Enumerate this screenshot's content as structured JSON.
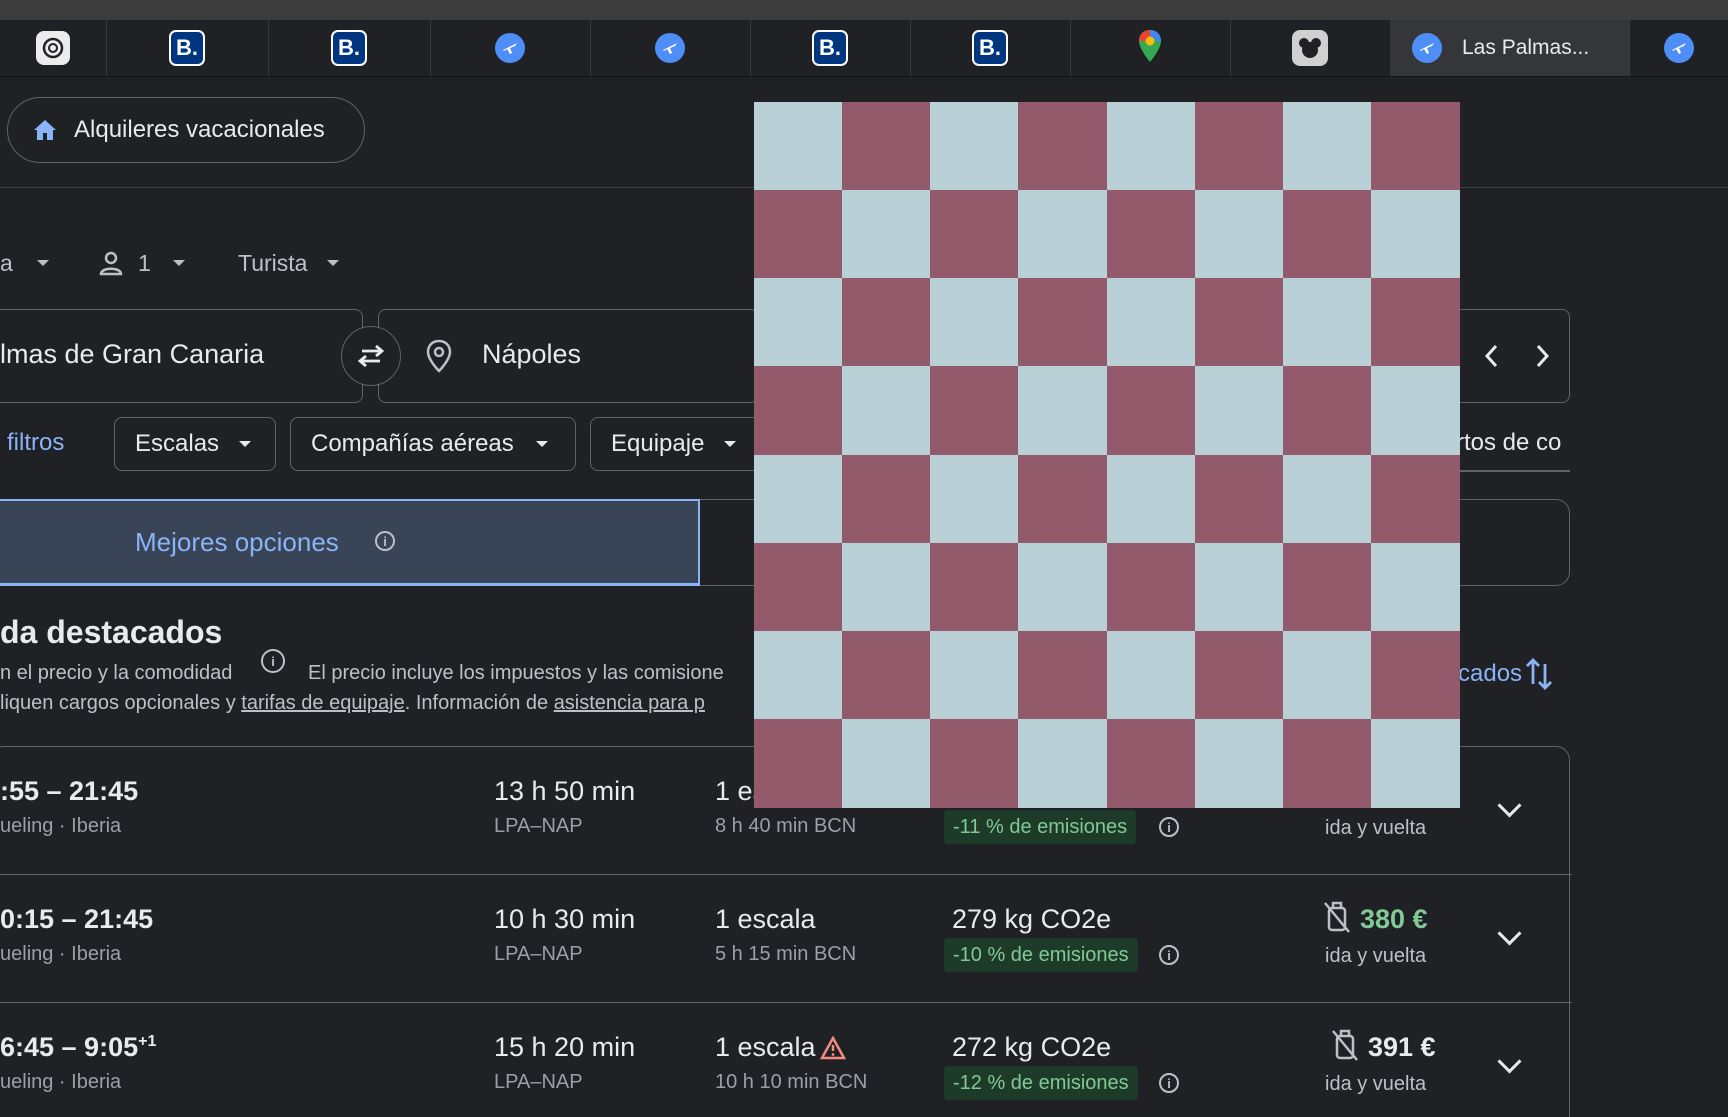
{
  "browser": {
    "active_tab_title": "Las Palmas...",
    "favicon_b_label": "B."
  },
  "header": {
    "vacation_rentals_label": "Alquileres vacacionales"
  },
  "search": {
    "trip_type_partial": "a",
    "passengers": "1",
    "cabin_class": "Turista",
    "origin": "lmas de Gran Canaria",
    "destination": "Nápoles",
    "partial_right_text": "rtos de co"
  },
  "filters": {
    "all_filters": "filtros",
    "stops": "Escalas",
    "airlines": "Compañías aéreas",
    "baggage": "Equipaje"
  },
  "tabs": {
    "best_options": "Mejores opciones"
  },
  "results": {
    "section_title": "da destacados",
    "subtitle_left": "n el precio y la comodidad",
    "price_note": "El precio incluye los impuestos y las comisione",
    "fees_prefix": "liquen cargos opcionales y ",
    "baggage_fees_link": "tarifas de equipaje",
    "info_prefix": ". Información de ",
    "assistance_link": "asistencia para p",
    "sort_partial": "cados",
    "flights": [
      {
        "times": ":55 – 21:45",
        "times_suffix": "",
        "airlines": "ueling · Iberia",
        "duration": "13 h 50 min",
        "route": "LPA–NAP",
        "stops": "1 es",
        "layover": "8 h 40 min BCN",
        "co2": "",
        "emissions": "-11 % de emisiones",
        "price": "",
        "price_note": "ida y vuelta"
      },
      {
        "times": "0:15 – 21:45",
        "times_suffix": "",
        "airlines": "ueling · Iberia",
        "duration": "10 h 30 min",
        "route": "LPA–NAP",
        "stops": "1 escala",
        "layover": "5 h 15 min BCN",
        "co2": "279 kg CO2e",
        "emissions": "-10 % de emisiones",
        "price": "380 €",
        "price_note": "ida y vuelta"
      },
      {
        "times": "6:45 – 9:05",
        "times_suffix": "+1",
        "airlines": "ueling · Iberia",
        "duration": "15 h 20 min",
        "route": "LPA–NAP",
        "stops": "1 escala",
        "layover": "10 h 10 min BCN",
        "co2": "272 kg CO2e",
        "emissions": "-12 % de emisiones",
        "price": "391 €",
        "price_note": "ida y vuelta"
      }
    ]
  },
  "colors": {
    "checker_light": "#b9d1d6",
    "checker_dark": "#925a6b",
    "accent_blue": "#8ab4f8",
    "price_green": "#81c995"
  }
}
